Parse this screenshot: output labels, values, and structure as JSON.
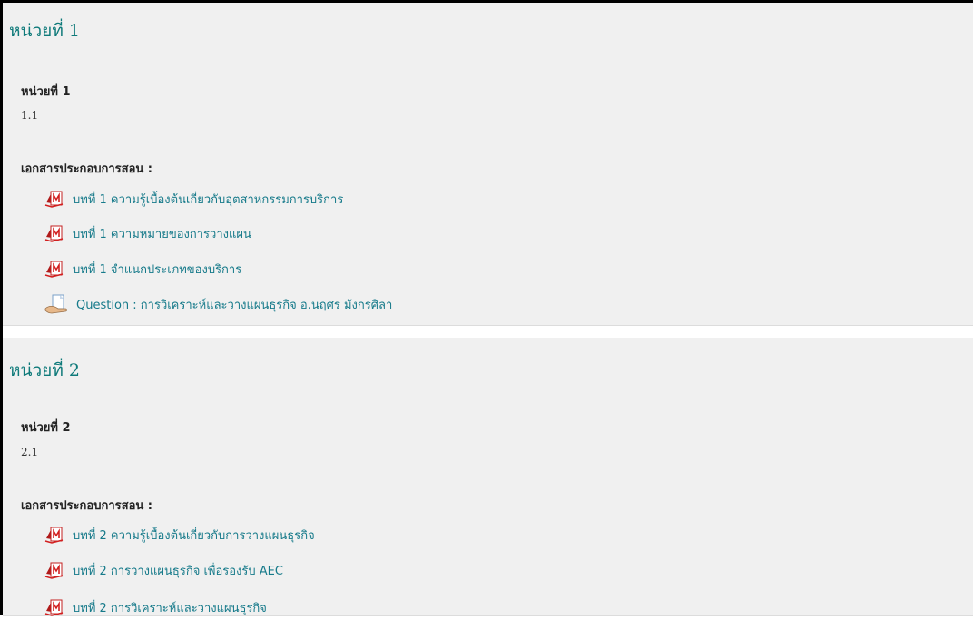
{
  "sections": [
    {
      "title": "หน่วยที่ 1",
      "unit_heading": "หน่วยที่ 1",
      "unit_sub": "1.1",
      "materials_label": "เอกสารประกอบการสอน :",
      "resources": [
        {
          "icon": "pdf-icon",
          "label": "บทที่ 1 ความรู้เบื้องต้นเกี่ยวกับอุตสาหกรรมการบริการ"
        },
        {
          "icon": "pdf-icon",
          "label": "บทที่ 1 ความหมายของการวางแผน"
        },
        {
          "icon": "pdf-icon",
          "label": "บทที่ 1 จำแนกประเภทของบริการ"
        },
        {
          "icon": "question-icon",
          "label": "Question : การวิเคราะห์และวางแผนธุรกิจ อ.นฤศร มังกรศิลา"
        }
      ]
    },
    {
      "title": "หน่วยที่ 2",
      "unit_heading": "หน่วยที่ 2",
      "unit_sub": "2.1",
      "materials_label": "เอกสารประกอบการสอน :",
      "resources": [
        {
          "icon": "pdf-icon",
          "label": "บทที่ 2 ความรู้เบื้องต้นเกี่ยวกับการวางแผนธุรกิจ"
        },
        {
          "icon": "pdf-icon",
          "label": "บทที่ 2 การวางแผนธุรกิจ เพื่อรองรับ AEC"
        },
        {
          "icon": "pdf-icon",
          "label": "บทที่ 2 การวิเคราะห์และวางแผนธุรกิจ"
        }
      ]
    }
  ],
  "colors": {
    "section_bg": "#f0f0f0",
    "title": "#0f7a7a",
    "link": "#167a8a",
    "pdf_red": "#d21f1f"
  }
}
